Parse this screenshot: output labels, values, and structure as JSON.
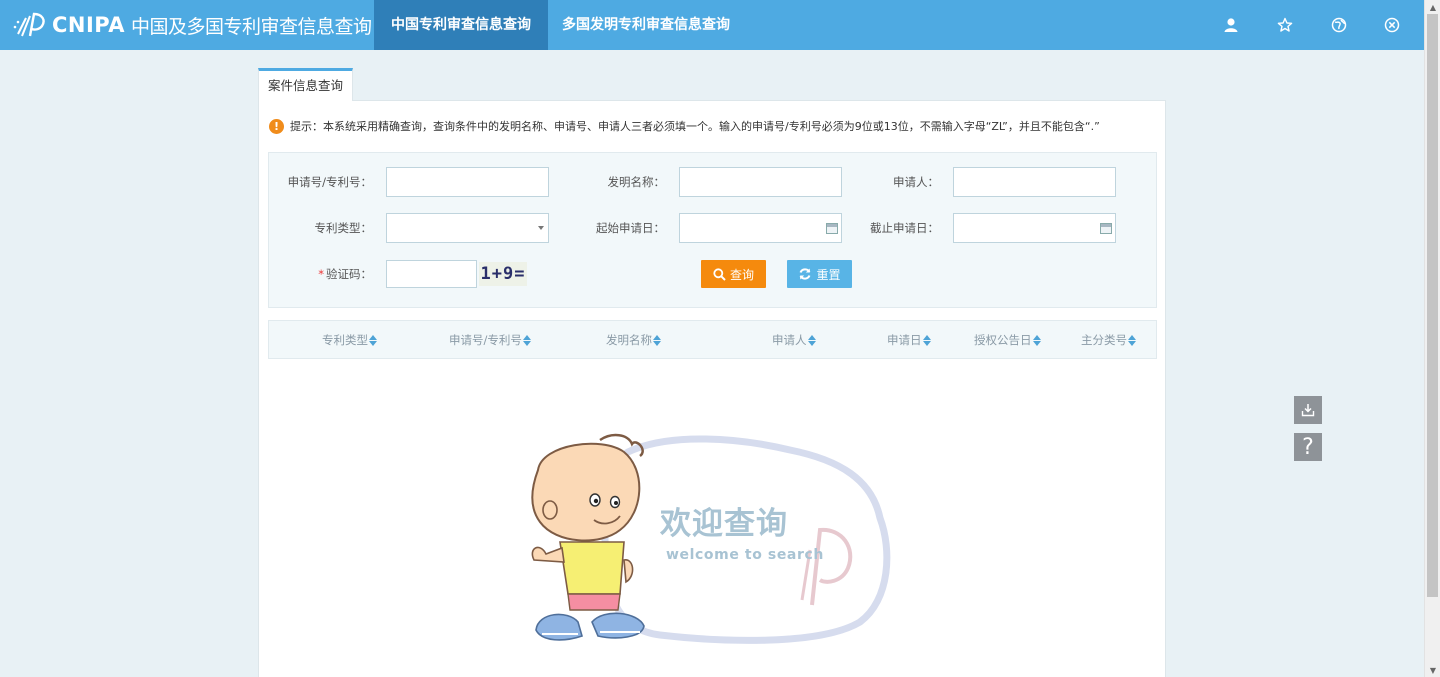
{
  "header": {
    "logo_en": "CNIPA",
    "logo_zh": "中国及多国专利审查信息查询",
    "tabs": [
      {
        "label": "中国专利审查信息查询",
        "active": true
      },
      {
        "label": "多国发明专利审查信息查询",
        "active": false
      }
    ],
    "icons": [
      "user-icon",
      "star-icon",
      "globe-icon",
      "close-circle-icon"
    ],
    "bg_color": "#4eaae2",
    "active_tab_color": "#2f7fb8"
  },
  "panel": {
    "tab_label": "案件信息查询",
    "hint": "提示：本系统采用精确查询，查询条件中的发明名称、申请号、申请人三者必须填一个。输入的申请号/专利号必须为9位或13位，不需输入字母“ZL”，并且不能包含“.”"
  },
  "form": {
    "app_no_label": "申请号/专利号：",
    "invention_name_label": "发明名称：",
    "applicant_label": "申请人：",
    "patent_type_label": "专利类型：",
    "start_date_label": "起始申请日：",
    "end_date_label": "截止申请日：",
    "captcha_required_mark": "*",
    "captcha_label": "验证码：",
    "captcha_text": "1+9=",
    "app_no_value": "",
    "invention_name_value": "",
    "applicant_value": "",
    "patent_type_value": "",
    "start_date_value": "",
    "end_date_value": "",
    "captcha_value": "",
    "search_button": "查询",
    "reset_button": "重置",
    "search_color": "#f58a0d",
    "reset_color": "#58b4e6"
  },
  "table": {
    "columns": [
      "专利类型",
      "申请号/专利号",
      "发明名称",
      "申请人",
      "申请日",
      "授权公告日",
      "主分类号"
    ]
  },
  "welcome": {
    "title": "欢迎查询",
    "subtitle": "welcome to search"
  },
  "side_tools": [
    "download-icon",
    "help-icon"
  ]
}
